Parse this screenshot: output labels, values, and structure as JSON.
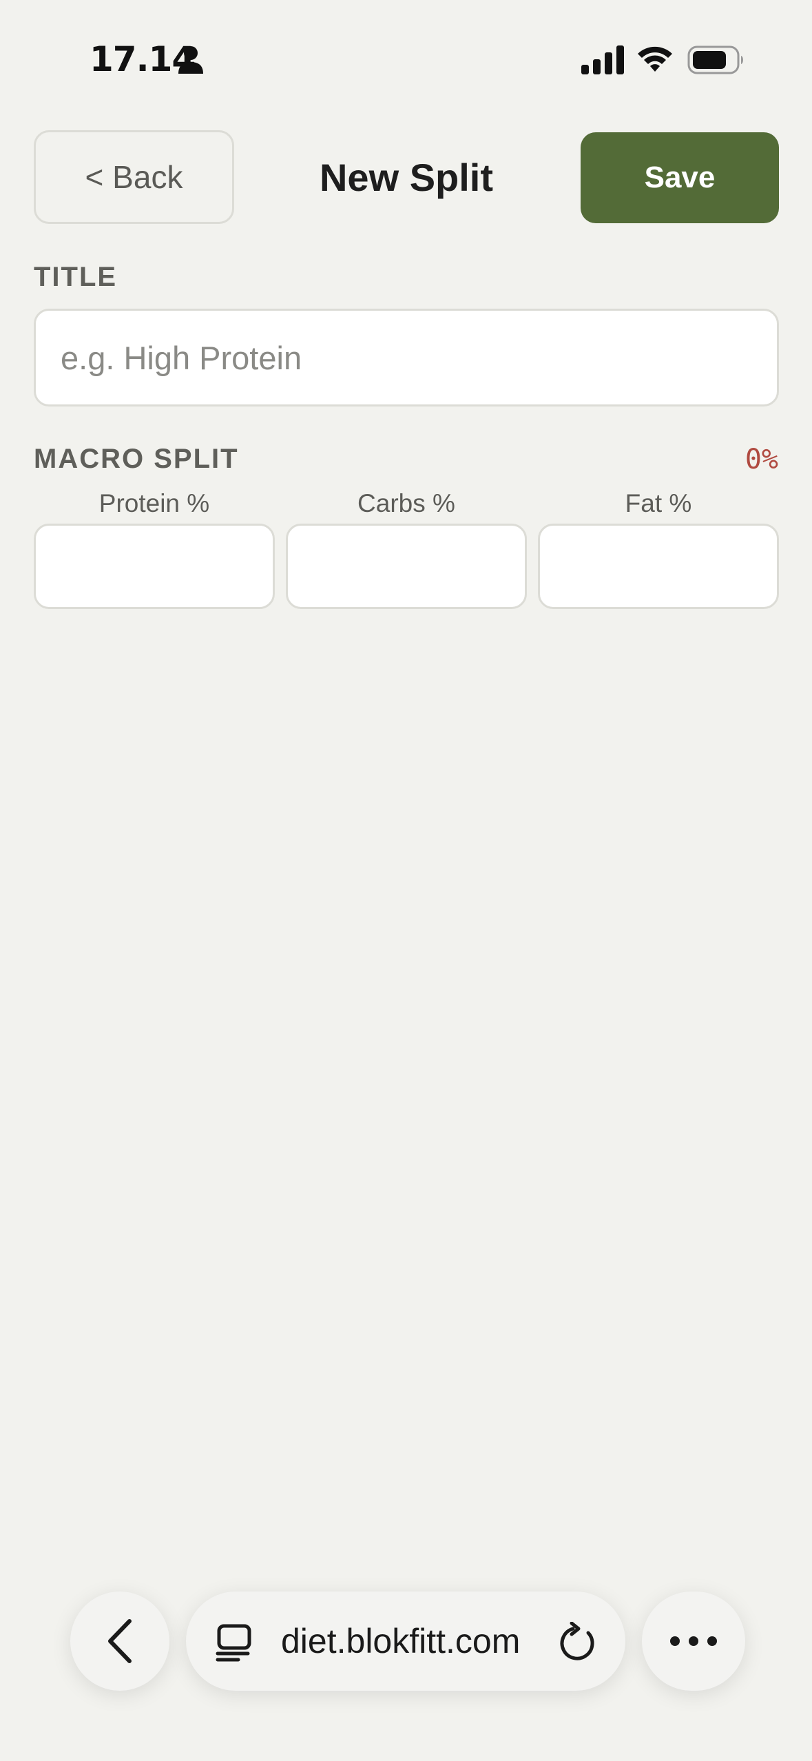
{
  "status_bar": {
    "time": "17.14",
    "icons": [
      "person-icon",
      "signal-icon",
      "wifi-icon",
      "battery-icon"
    ]
  },
  "header": {
    "back_label": "< Back",
    "title": "New Split",
    "save_label": "Save"
  },
  "title_section": {
    "label": "TITLE",
    "input_value": "",
    "placeholder": "e.g. High Protein"
  },
  "macro_section": {
    "label": "MACRO SPLIT",
    "total": "0%",
    "fields": [
      {
        "label": "Protein %",
        "value": ""
      },
      {
        "label": "Carbs %",
        "value": ""
      },
      {
        "label": "Fat %",
        "value": ""
      }
    ]
  },
  "browser": {
    "url": "diet.blokfitt.com",
    "icons": [
      "chevron-left-icon",
      "tabs-icon",
      "reload-icon",
      "more-icon"
    ]
  },
  "colors": {
    "background": "#f2f2ee",
    "accent": "#536b37",
    "total_warning": "#b04a40"
  }
}
